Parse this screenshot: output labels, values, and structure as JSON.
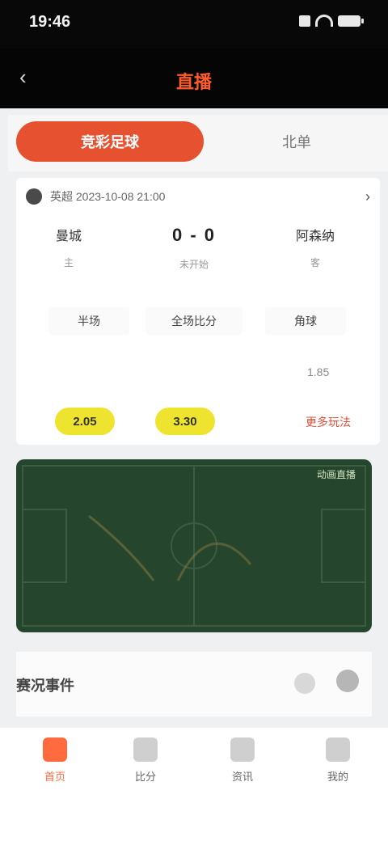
{
  "status": {
    "time": "19:46"
  },
  "header": {
    "back_icon": "back-arrow-icon",
    "title": "直播"
  },
  "segments": [
    {
      "label": "竞彩足球",
      "active": true
    },
    {
      "label": "北单",
      "active": false
    }
  ],
  "match_card": {
    "league": "英超 2023-10-08 21:00",
    "more": "›",
    "home": {
      "name": "曼城",
      "sub": "主"
    },
    "score": "0 - 0",
    "score_sub": "未开始",
    "away": {
      "name": "阿森纳",
      "sub": "客"
    },
    "chips": [
      "半场",
      "全场比分",
      "角球"
    ],
    "odds_info": "1.85",
    "odds": [
      "2.05",
      "3.30"
    ],
    "red_label": "更多玩法"
  },
  "pitch": {
    "caption": "动画直播"
  },
  "section": {
    "title": "赛况事件"
  },
  "tabs": [
    {
      "label": "首页",
      "icon": "home-icon",
      "active": true
    },
    {
      "label": "比分",
      "icon": "score-icon",
      "active": false
    },
    {
      "label": "资讯",
      "icon": "news-icon",
      "active": false
    },
    {
      "label": "我的",
      "icon": "user-icon",
      "active": false
    }
  ]
}
